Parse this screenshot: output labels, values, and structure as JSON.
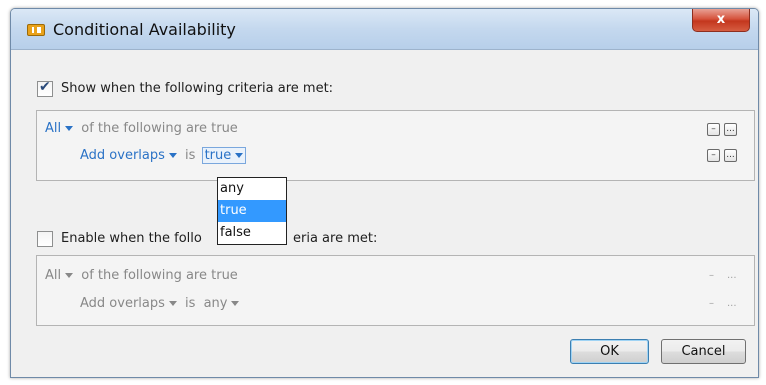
{
  "dialog": {
    "title": "Conditional Availability",
    "close_label": "x"
  },
  "show_section": {
    "checked": true,
    "label": "Show when the following criteria are met:",
    "quantifier": "All",
    "quantifier_suffix": "of the following are true",
    "condition_field": "Add overlaps",
    "condition_op": "is",
    "condition_value": "true",
    "minus_label": "–",
    "more_label": "..."
  },
  "dropdown": {
    "options": [
      "any",
      "true",
      "false"
    ],
    "selected": "true"
  },
  "enable_section": {
    "checked": false,
    "label_part1": "Enable when the follo",
    "label_part2": "eria are met:",
    "quantifier": "All",
    "quantifier_suffix": "of the following are true",
    "condition_field": "Add overlaps",
    "condition_op": "is",
    "condition_value": "any",
    "minus_label": "–",
    "more_label": "..."
  },
  "buttons": {
    "ok": "OK",
    "cancel": "Cancel"
  }
}
